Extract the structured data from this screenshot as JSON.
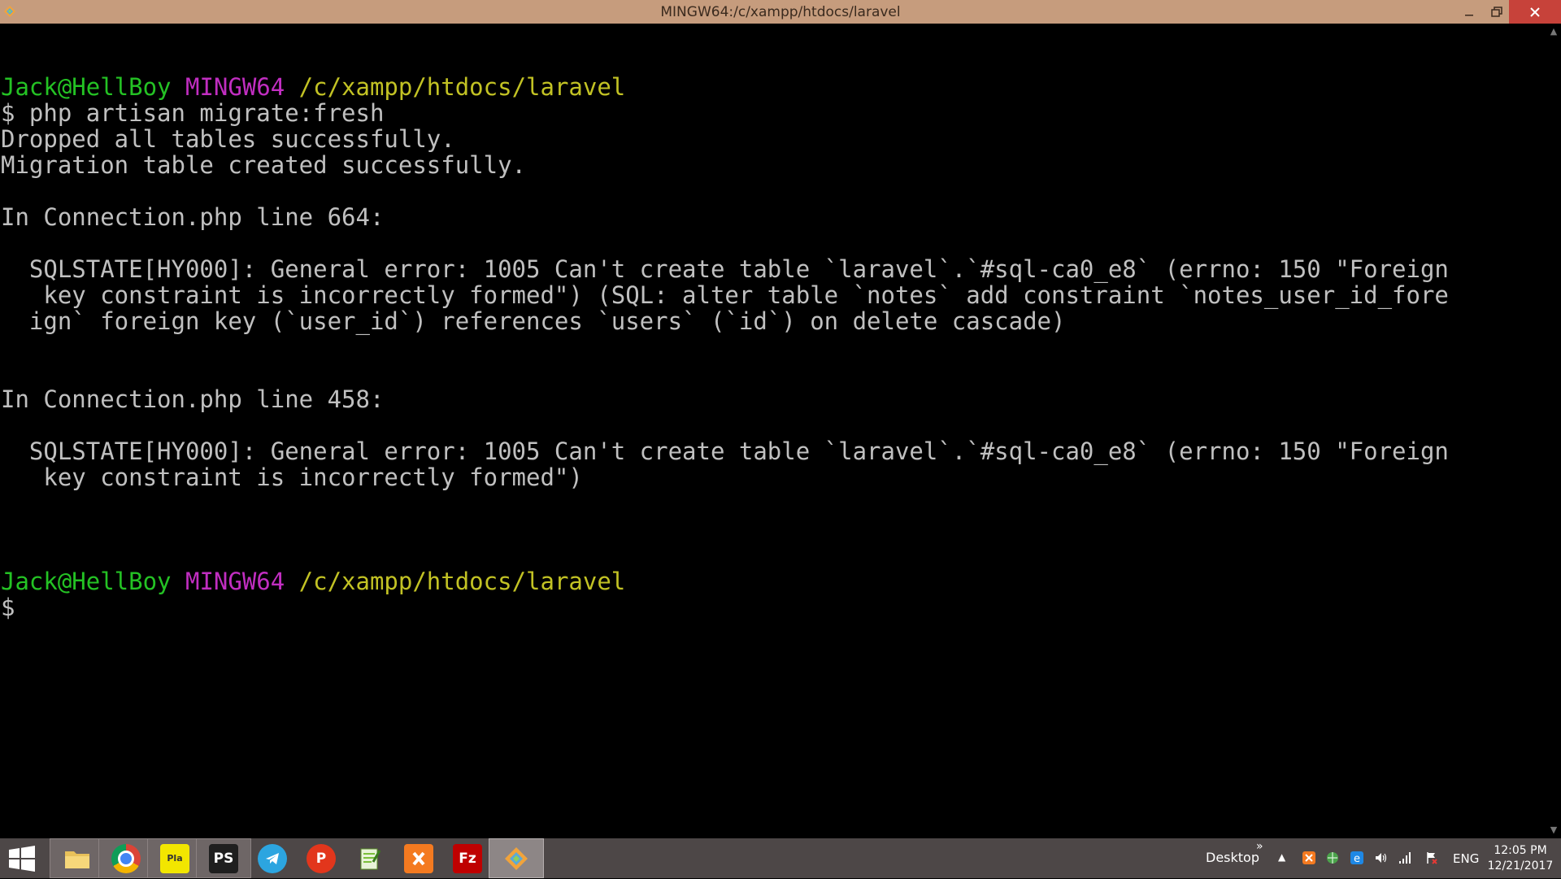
{
  "window": {
    "title": "MINGW64:/c/xampp/htdocs/laravel"
  },
  "terminal": {
    "lines": [
      {
        "parts": [
          {
            "t": "",
            "c": "white"
          }
        ]
      },
      {
        "parts": [
          {
            "t": "Jack@HellBoy",
            "c": "green"
          },
          {
            "t": " ",
            "c": "white"
          },
          {
            "t": "MINGW64",
            "c": "magenta"
          },
          {
            "t": " ",
            "c": "white"
          },
          {
            "t": "/c/xampp/htdocs/laravel",
            "c": "yellow"
          }
        ]
      },
      {
        "parts": [
          {
            "t": "$ php artisan migrate:fresh",
            "c": "white"
          }
        ]
      },
      {
        "parts": [
          {
            "t": "Dropped all tables successfully.",
            "c": "white"
          }
        ]
      },
      {
        "parts": [
          {
            "t": "Migration table created successfully.",
            "c": "white"
          }
        ]
      },
      {
        "parts": [
          {
            "t": "",
            "c": "white"
          }
        ]
      },
      {
        "parts": [
          {
            "t": "In Connection.php line 664:",
            "c": "white"
          }
        ]
      },
      {
        "parts": [
          {
            "t": "",
            "c": "white"
          }
        ]
      },
      {
        "parts": [
          {
            "t": "  SQLSTATE[HY000]: General error: 1005 Can't create table `laravel`.`#sql-ca0_e8` (errno: 150 \"Foreign",
            "c": "white"
          }
        ]
      },
      {
        "parts": [
          {
            "t": "   key constraint is incorrectly formed\") (SQL: alter table `notes` add constraint `notes_user_id_fore",
            "c": "white"
          }
        ]
      },
      {
        "parts": [
          {
            "t": "  ign` foreign key (`user_id`) references `users` (`id`) on delete cascade)",
            "c": "white"
          }
        ]
      },
      {
        "parts": [
          {
            "t": "",
            "c": "white"
          }
        ]
      },
      {
        "parts": [
          {
            "t": "",
            "c": "white"
          }
        ]
      },
      {
        "parts": [
          {
            "t": "In Connection.php line 458:",
            "c": "white"
          }
        ]
      },
      {
        "parts": [
          {
            "t": "",
            "c": "white"
          }
        ]
      },
      {
        "parts": [
          {
            "t": "  SQLSTATE[HY000]: General error: 1005 Can't create table `laravel`.`#sql-ca0_e8` (errno: 150 \"Foreign",
            "c": "white"
          }
        ]
      },
      {
        "parts": [
          {
            "t": "   key constraint is incorrectly formed\")",
            "c": "white"
          }
        ]
      },
      {
        "parts": [
          {
            "t": "",
            "c": "white"
          }
        ]
      },
      {
        "parts": [
          {
            "t": "",
            "c": "white"
          }
        ]
      },
      {
        "parts": [
          {
            "t": "",
            "c": "white"
          }
        ]
      },
      {
        "parts": [
          {
            "t": "Jack@HellBoy",
            "c": "green"
          },
          {
            "t": " ",
            "c": "white"
          },
          {
            "t": "MINGW64",
            "c": "magenta"
          },
          {
            "t": " ",
            "c": "white"
          },
          {
            "t": "/c/xampp/htdocs/laravel",
            "c": "yellow"
          }
        ]
      },
      {
        "parts": [
          {
            "t": "$",
            "c": "white"
          }
        ]
      }
    ]
  },
  "taskbar": {
    "apps": [
      {
        "name": "file-explorer",
        "icon": "folder-icon",
        "label": "",
        "color": "#e8c15a",
        "state": "pinned"
      },
      {
        "name": "chrome",
        "icon": "chrome-icon",
        "label": "",
        "color": "#dd4b39",
        "state": "pinned"
      },
      {
        "name": "player",
        "icon": "player-icon",
        "label": "Pla",
        "color": "#f2e600",
        "state": "pinned"
      },
      {
        "name": "phpstorm",
        "icon": "phpstorm-icon",
        "label": "PS",
        "color": "#1f1f1f",
        "state": "pinned"
      },
      {
        "name": "telegram",
        "icon": "telegram-icon",
        "label": "",
        "color": "#2ca5e0",
        "state": "normal"
      },
      {
        "name": "postman",
        "icon": "postman-icon",
        "label": "P",
        "color": "#e2361c",
        "state": "normal"
      },
      {
        "name": "notepad-plus",
        "icon": "notepad-icon",
        "label": "",
        "color": "#7bbf3b",
        "state": "normal"
      },
      {
        "name": "xampp",
        "icon": "xampp-icon",
        "label": "",
        "color": "#f47a20",
        "state": "normal"
      },
      {
        "name": "filezilla",
        "icon": "filezilla-icon",
        "label": "Fz",
        "color": "#bf0000",
        "state": "normal"
      },
      {
        "name": "git-bash",
        "icon": "git-icon",
        "label": "",
        "color": "#8ea6c9",
        "state": "active"
      }
    ],
    "tray": {
      "desktop_label": "Desktop",
      "chevron": "»",
      "language": "ENG",
      "time": "12:05 PM",
      "date": "12/21/2017"
    }
  },
  "colors": {
    "titlebar": "#c69c7d",
    "terminal_bg": "#000000",
    "green": "#24c224",
    "magenta": "#c12ec1",
    "yellow": "#c2c224",
    "text": "#c0c0c0",
    "taskbar": "#4d4747"
  }
}
